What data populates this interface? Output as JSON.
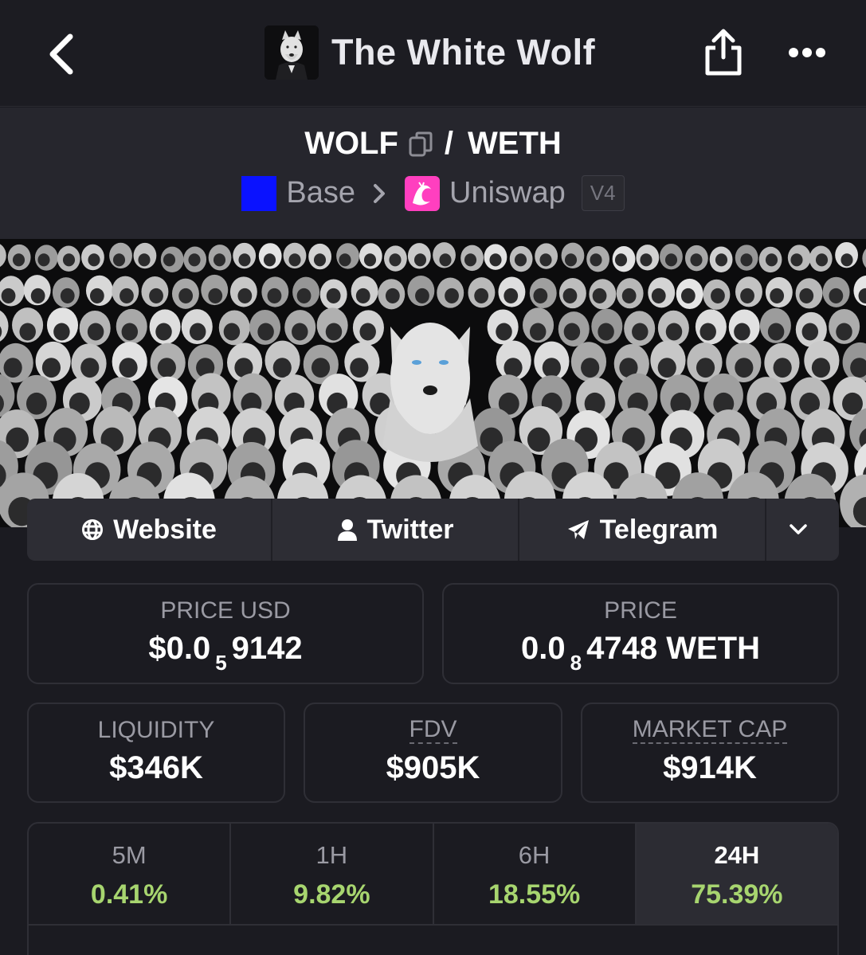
{
  "header": {
    "title": "The White Wolf",
    "back_icon": "chevron-left-icon",
    "share_icon": "share-icon",
    "more_icon": "more-dots-icon"
  },
  "pair": {
    "base": "WOLF",
    "separator": "/",
    "quote": "WETH",
    "chain": "Base",
    "chain_color": "#0a12ff",
    "dex": "Uniswap",
    "dex_color": "#ff3fbf",
    "version": "V4"
  },
  "links": {
    "website": "Website",
    "twitter": "Twitter",
    "telegram": "Telegram"
  },
  "stats": {
    "price_usd": {
      "label": "PRICE USD",
      "prefix": "$0.0",
      "zeros": "5",
      "digits": "9142"
    },
    "price": {
      "label": "PRICE",
      "prefix": "0.0",
      "zeros": "8",
      "digits": "4748 WETH"
    },
    "liquidity": {
      "label": "LIQUIDITY",
      "value": "$346K"
    },
    "fdv": {
      "label": "FDV",
      "value": "$905K"
    },
    "market_cap": {
      "label": "MARKET CAP",
      "value": "$914K"
    }
  },
  "periods": [
    {
      "label": "5M",
      "change": "0.41%"
    },
    {
      "label": "1H",
      "change": "9.82%"
    },
    {
      "label": "6H",
      "change": "18.55%"
    },
    {
      "label": "24H",
      "change": "75.39%"
    }
  ],
  "colors": {
    "positive": "#a7d56f",
    "background": "#1b1b21"
  }
}
